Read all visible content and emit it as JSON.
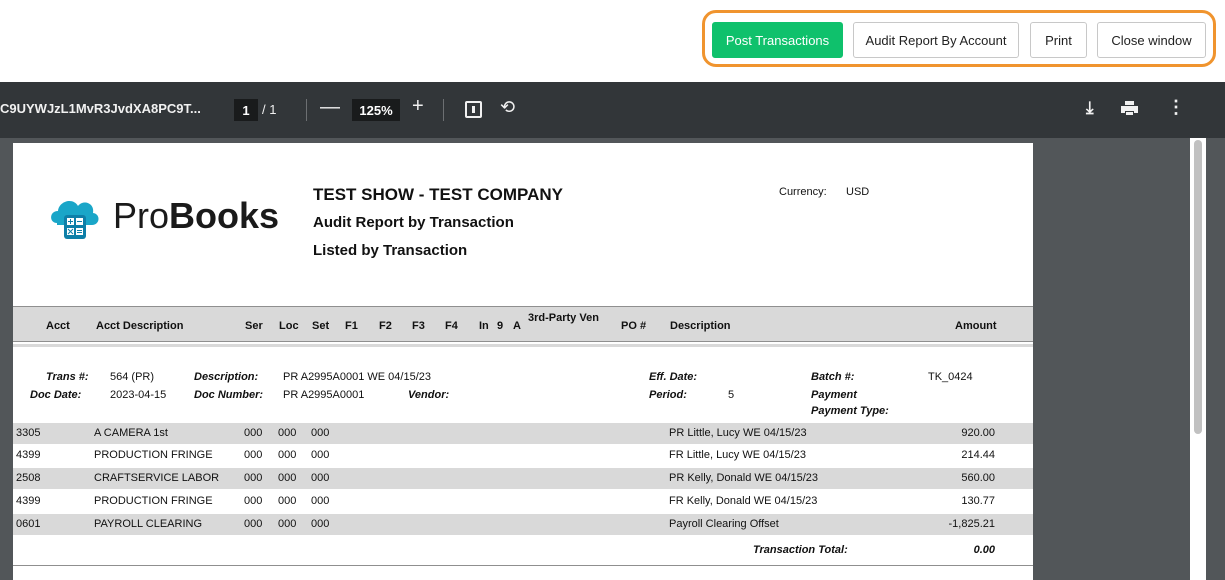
{
  "actions": {
    "post": "Post Transactions",
    "audit": "Audit Report By Account",
    "print": "Print",
    "close": "Close window"
  },
  "viewer": {
    "file_title": "C9UYWJzL1MvR3JvdXA8PC9T...",
    "page_current": "1",
    "page_total": "/ 1",
    "zoom": "125%"
  },
  "report": {
    "brand_pre": "Pro",
    "brand_bold": "Books",
    "company": "TEST SHOW - TEST COMPANY",
    "title": "Audit Report by Transaction",
    "subtitle": "Listed by Transaction",
    "currency_label": "Currency:",
    "currency": "USD"
  },
  "columns": {
    "acct": "Acct",
    "acct_desc": "Acct Description",
    "ser": "Ser",
    "loc": "Loc",
    "set": "Set",
    "f1": "F1",
    "f2": "F2",
    "f3": "F3",
    "f4": "F4",
    "in": "In",
    "nine": "9",
    "a": "A",
    "third_party": "3rd-Party Ven",
    "po": "PO #",
    "description": "Description",
    "amount": "Amount"
  },
  "transaction": {
    "trans_label": "Trans #:",
    "trans_val": "564  (PR)",
    "desc_label": "Description:",
    "desc_val": "PR A2995A0001 WE 04/15/23",
    "docdate_label": "Doc Date:",
    "docdate_val": "2023-04-15",
    "docnum_label": "Doc Number:",
    "docnum_val": "PR A2995A0001",
    "vendor_label": "Vendor:",
    "effdate_label": "Eff. Date:",
    "period_label": "Period:",
    "period_val": "5",
    "batch_label": "Batch #:",
    "batch_val": "TK_0424",
    "payment_label": "Payment",
    "payment_type_label": "Payment Type:",
    "total_label": "Transaction Total:",
    "total_val": "0.00"
  },
  "rows": [
    {
      "acct": "3305",
      "desc": "A CAMERA 1st",
      "ser": "000",
      "loc": "000",
      "set": "000",
      "line": "PR Little, Lucy WE 04/15/23",
      "amount": "920.00"
    },
    {
      "acct": "4399",
      "desc": "PRODUCTION FRINGE",
      "ser": "000",
      "loc": "000",
      "set": "000",
      "line": "FR Little, Lucy WE 04/15/23",
      "amount": "214.44"
    },
    {
      "acct": "2508",
      "desc": "CRAFTSERVICE LABOR",
      "ser": "000",
      "loc": "000",
      "set": "000",
      "line": "PR Kelly, Donald WE 04/15/23",
      "amount": "560.00"
    },
    {
      "acct": "4399",
      "desc": "PRODUCTION FRINGE",
      "ser": "000",
      "loc": "000",
      "set": "000",
      "line": "FR Kelly, Donald WE 04/15/23",
      "amount": "130.77"
    },
    {
      "acct": "0601",
      "desc": "PAYROLL CLEARING",
      "ser": "000",
      "loc": "000",
      "set": "000",
      "line": "Payroll Clearing Offset",
      "amount": "-1,825.21"
    }
  ]
}
